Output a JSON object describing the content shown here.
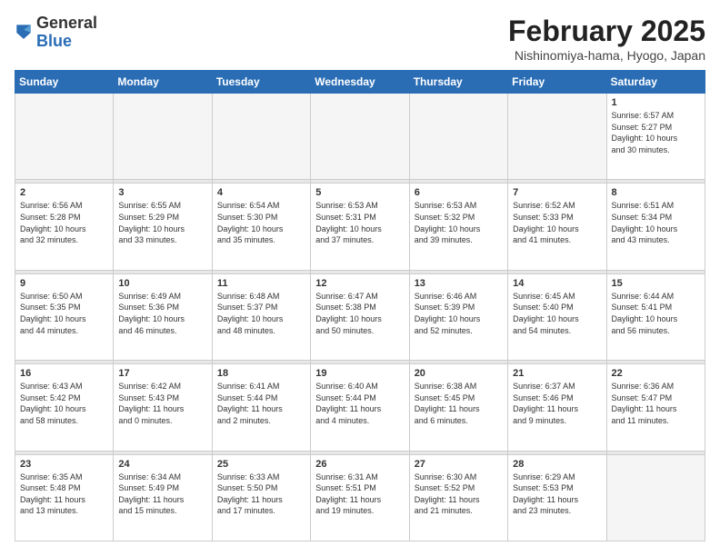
{
  "header": {
    "logo_general": "General",
    "logo_blue": "Blue",
    "month_title": "February 2025",
    "location": "Nishinomiya-hama, Hyogo, Japan"
  },
  "weekdays": [
    "Sunday",
    "Monday",
    "Tuesday",
    "Wednesday",
    "Thursday",
    "Friday",
    "Saturday"
  ],
  "weeks": [
    [
      {
        "day": "",
        "info": ""
      },
      {
        "day": "",
        "info": ""
      },
      {
        "day": "",
        "info": ""
      },
      {
        "day": "",
        "info": ""
      },
      {
        "day": "",
        "info": ""
      },
      {
        "day": "",
        "info": ""
      },
      {
        "day": "1",
        "info": "Sunrise: 6:57 AM\nSunset: 5:27 PM\nDaylight: 10 hours\nand 30 minutes."
      }
    ],
    [
      {
        "day": "2",
        "info": "Sunrise: 6:56 AM\nSunset: 5:28 PM\nDaylight: 10 hours\nand 32 minutes."
      },
      {
        "day": "3",
        "info": "Sunrise: 6:55 AM\nSunset: 5:29 PM\nDaylight: 10 hours\nand 33 minutes."
      },
      {
        "day": "4",
        "info": "Sunrise: 6:54 AM\nSunset: 5:30 PM\nDaylight: 10 hours\nand 35 minutes."
      },
      {
        "day": "5",
        "info": "Sunrise: 6:53 AM\nSunset: 5:31 PM\nDaylight: 10 hours\nand 37 minutes."
      },
      {
        "day": "6",
        "info": "Sunrise: 6:53 AM\nSunset: 5:32 PM\nDaylight: 10 hours\nand 39 minutes."
      },
      {
        "day": "7",
        "info": "Sunrise: 6:52 AM\nSunset: 5:33 PM\nDaylight: 10 hours\nand 41 minutes."
      },
      {
        "day": "8",
        "info": "Sunrise: 6:51 AM\nSunset: 5:34 PM\nDaylight: 10 hours\nand 43 minutes."
      }
    ],
    [
      {
        "day": "9",
        "info": "Sunrise: 6:50 AM\nSunset: 5:35 PM\nDaylight: 10 hours\nand 44 minutes."
      },
      {
        "day": "10",
        "info": "Sunrise: 6:49 AM\nSunset: 5:36 PM\nDaylight: 10 hours\nand 46 minutes."
      },
      {
        "day": "11",
        "info": "Sunrise: 6:48 AM\nSunset: 5:37 PM\nDaylight: 10 hours\nand 48 minutes."
      },
      {
        "day": "12",
        "info": "Sunrise: 6:47 AM\nSunset: 5:38 PM\nDaylight: 10 hours\nand 50 minutes."
      },
      {
        "day": "13",
        "info": "Sunrise: 6:46 AM\nSunset: 5:39 PM\nDaylight: 10 hours\nand 52 minutes."
      },
      {
        "day": "14",
        "info": "Sunrise: 6:45 AM\nSunset: 5:40 PM\nDaylight: 10 hours\nand 54 minutes."
      },
      {
        "day": "15",
        "info": "Sunrise: 6:44 AM\nSunset: 5:41 PM\nDaylight: 10 hours\nand 56 minutes."
      }
    ],
    [
      {
        "day": "16",
        "info": "Sunrise: 6:43 AM\nSunset: 5:42 PM\nDaylight: 10 hours\nand 58 minutes."
      },
      {
        "day": "17",
        "info": "Sunrise: 6:42 AM\nSunset: 5:43 PM\nDaylight: 11 hours\nand 0 minutes."
      },
      {
        "day": "18",
        "info": "Sunrise: 6:41 AM\nSunset: 5:44 PM\nDaylight: 11 hours\nand 2 minutes."
      },
      {
        "day": "19",
        "info": "Sunrise: 6:40 AM\nSunset: 5:44 PM\nDaylight: 11 hours\nand 4 minutes."
      },
      {
        "day": "20",
        "info": "Sunrise: 6:38 AM\nSunset: 5:45 PM\nDaylight: 11 hours\nand 6 minutes."
      },
      {
        "day": "21",
        "info": "Sunrise: 6:37 AM\nSunset: 5:46 PM\nDaylight: 11 hours\nand 9 minutes."
      },
      {
        "day": "22",
        "info": "Sunrise: 6:36 AM\nSunset: 5:47 PM\nDaylight: 11 hours\nand 11 minutes."
      }
    ],
    [
      {
        "day": "23",
        "info": "Sunrise: 6:35 AM\nSunset: 5:48 PM\nDaylight: 11 hours\nand 13 minutes."
      },
      {
        "day": "24",
        "info": "Sunrise: 6:34 AM\nSunset: 5:49 PM\nDaylight: 11 hours\nand 15 minutes."
      },
      {
        "day": "25",
        "info": "Sunrise: 6:33 AM\nSunset: 5:50 PM\nDaylight: 11 hours\nand 17 minutes."
      },
      {
        "day": "26",
        "info": "Sunrise: 6:31 AM\nSunset: 5:51 PM\nDaylight: 11 hours\nand 19 minutes."
      },
      {
        "day": "27",
        "info": "Sunrise: 6:30 AM\nSunset: 5:52 PM\nDaylight: 11 hours\nand 21 minutes."
      },
      {
        "day": "28",
        "info": "Sunrise: 6:29 AM\nSunset: 5:53 PM\nDaylight: 11 hours\nand 23 minutes."
      },
      {
        "day": "",
        "info": ""
      }
    ]
  ]
}
